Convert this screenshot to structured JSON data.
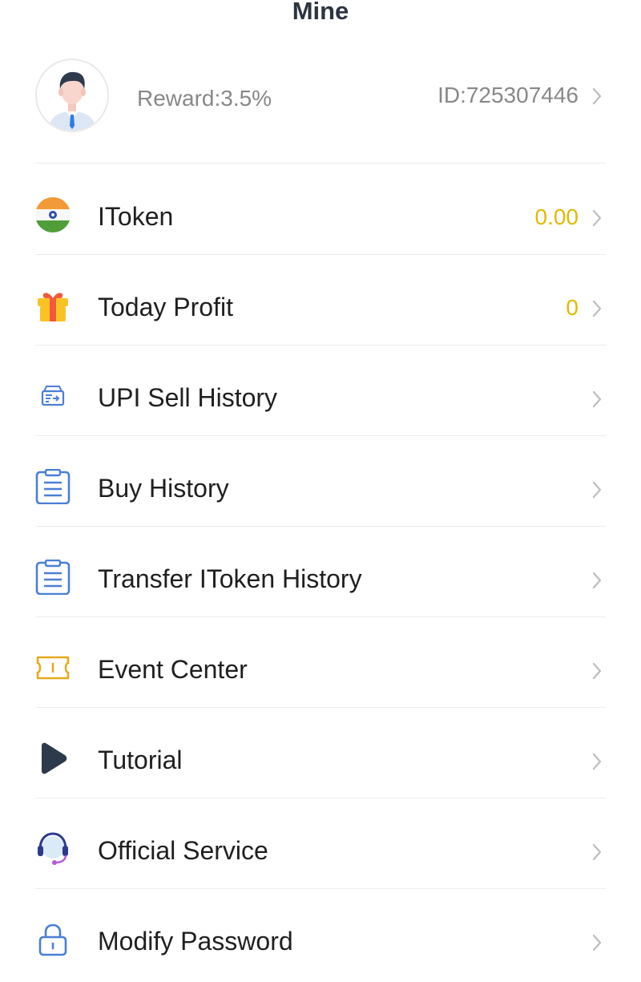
{
  "header": {
    "title": "Mine"
  },
  "profile": {
    "reward": "Reward:3.5%",
    "id": "ID:725307446"
  },
  "colors": {
    "accent_value": "#e4b800",
    "icon_blue": "#4a7fd6",
    "chevron": "#bdbdbd",
    "title": "#2b3440"
  },
  "menu": {
    "items": [
      {
        "label": "IToken",
        "value": "0.00",
        "icon": "india-flag-icon"
      },
      {
        "label": "Today Profit",
        "value": "0",
        "icon": "gift-icon"
      },
      {
        "label": "UPI Sell History",
        "value": "",
        "icon": "wallet-transfer-icon"
      },
      {
        "label": "Buy History",
        "value": "",
        "icon": "clipboard-icon"
      },
      {
        "label": "Transfer IToken History",
        "value": "",
        "icon": "clipboard-icon"
      },
      {
        "label": "Event Center",
        "value": "",
        "icon": "ticket-icon"
      },
      {
        "label": "Tutorial",
        "value": "",
        "icon": "play-icon"
      },
      {
        "label": "Official Service",
        "value": "",
        "icon": "headset-icon"
      },
      {
        "label": "Modify Password",
        "value": "",
        "icon": "lock-icon"
      }
    ]
  }
}
